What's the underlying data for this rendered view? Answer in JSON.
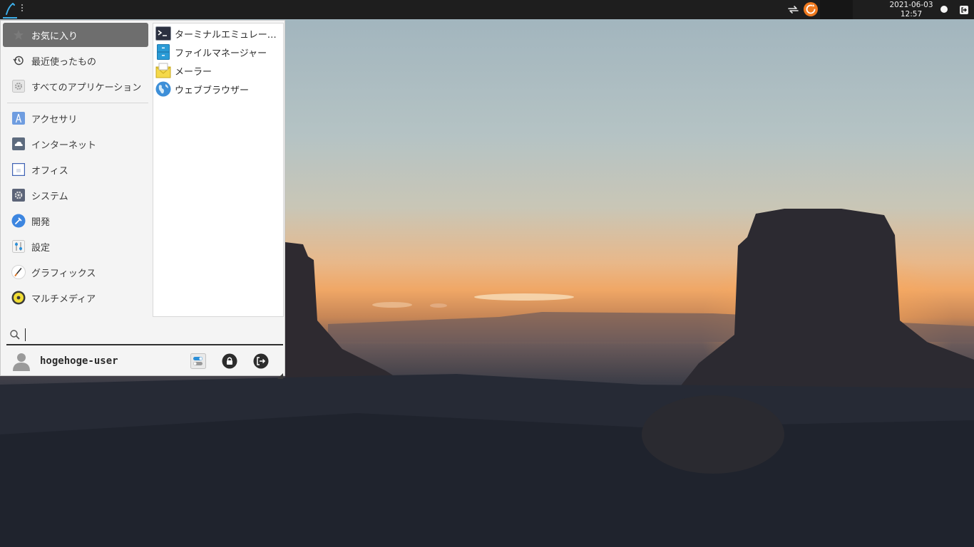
{
  "panel": {
    "clock_date": "2021-06-03",
    "clock_time": "12:57"
  },
  "menu": {
    "categories": [
      {
        "label": "お気に入り",
        "icon": "star-icon",
        "active": true
      },
      {
        "label": "最近使ったもの",
        "icon": "history-icon"
      },
      {
        "label": "すべてのアプリケーション",
        "icon": "all-apps-gear-icon"
      },
      {
        "label": "アクセサリ",
        "icon": "accessories-icon"
      },
      {
        "label": "インターネット",
        "icon": "internet-cloud-icon"
      },
      {
        "label": "オフィス",
        "icon": "office-document-icon"
      },
      {
        "label": "システム",
        "icon": "system-gear-icon"
      },
      {
        "label": "開発",
        "icon": "development-hammer-icon"
      },
      {
        "label": "設定",
        "icon": "settings-sliders-icon"
      },
      {
        "label": "グラフィックス",
        "icon": "graphics-brush-icon"
      },
      {
        "label": "マルチメディア",
        "icon": "multimedia-speaker-icon"
      }
    ],
    "apps": [
      {
        "label": "ターミナルエミュレーター",
        "icon": "terminal-icon"
      },
      {
        "label": "ファイルマネージャー",
        "icon": "file-manager-icon"
      },
      {
        "label": "メーラー",
        "icon": "mail-icon"
      },
      {
        "label": "ウェブブラウザー",
        "icon": "web-browser-globe-icon"
      }
    ],
    "search": {
      "value": "",
      "placeholder": ""
    },
    "user": {
      "name": "hogehoge-user"
    }
  },
  "colors": {
    "panel_bg": "#1e1e1e",
    "menu_bg": "#f4f4f4",
    "active_category_bg": "#6e6e6e",
    "accent": "#3daee9",
    "update_orange": "#f07a1f"
  }
}
